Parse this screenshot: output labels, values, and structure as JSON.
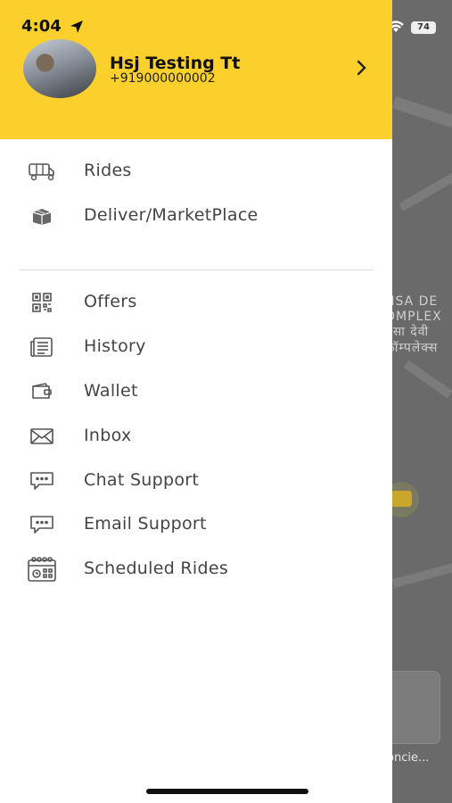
{
  "status": {
    "time": "4:04",
    "battery": "74"
  },
  "user": {
    "name": "Hsj Testing Tt",
    "phone": "+919000000002"
  },
  "menu_primary": [
    {
      "label": "Rides",
      "icon": "auto-rickshaw-icon"
    },
    {
      "label": "Deliver/MarketPlace",
      "icon": "package-icon"
    }
  ],
  "menu_secondary": [
    {
      "label": "Offers",
      "icon": "qr-code-icon"
    },
    {
      "label": "History",
      "icon": "history-list-icon"
    },
    {
      "label": "Wallet",
      "icon": "wallet-icon"
    },
    {
      "label": "Inbox",
      "icon": "envelope-icon"
    },
    {
      "label": "Chat Support",
      "icon": "chat-bubble-icon"
    },
    {
      "label": "Email Support",
      "icon": "chat-bubble-icon"
    },
    {
      "label": "Scheduled Rides",
      "icon": "calendar-icon"
    }
  ],
  "map": {
    "labels": [
      "NSA DE",
      "OMPLEX",
      "नसा देवी",
      "कॉम्पलेक्स"
    ],
    "card_caption": "oncie..."
  },
  "colors": {
    "header": "#fbd02d",
    "text": "#444444"
  }
}
